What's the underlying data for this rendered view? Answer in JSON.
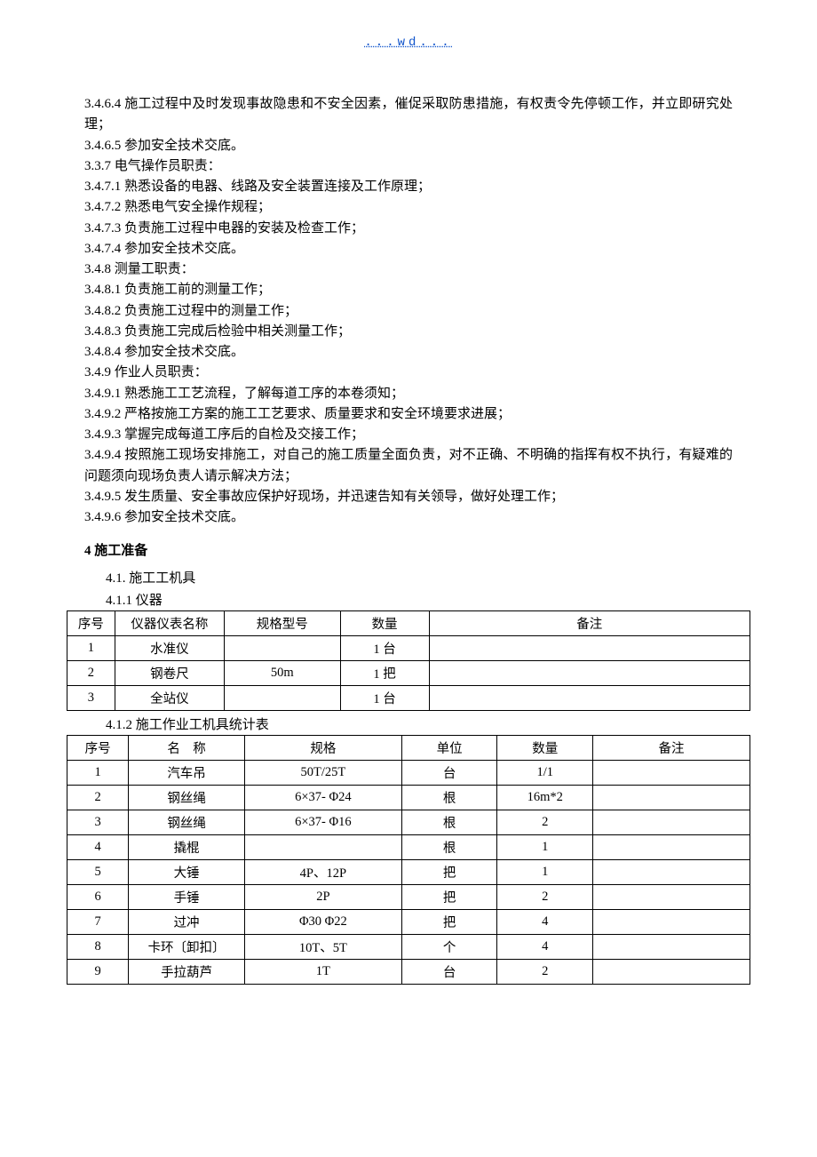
{
  "header_link": "...wd...",
  "paragraphs": [
    "3.4.6.4 施工过程中及时发现事故隐患和不安全因素，催促采取防患措施，有权责令先停顿工作，并立即研究处理；",
    "3.4.6.5 参加安全技术交底。",
    "3.3.7 电气操作员职责：",
    "3.4.7.1 熟悉设备的电器、线路及安全装置连接及工作原理；",
    "3.4.7.2 熟悉电气安全操作规程；",
    "3.4.7.3 负责施工过程中电器的安装及检查工作；",
    "3.4.7.4 参加安全技术交底。",
    "3.4.8 测量工职责：",
    "3.4.8.1 负责施工前的测量工作；",
    "3.4.8.2 负责施工过程中的测量工作；",
    "3.4.8.3 负责施工完成后检验中相关测量工作；",
    "3.4.8.4 参加安全技术交底。",
    "3.4.9 作业人员职责：",
    "3.4.9.1 熟悉施工工艺流程，了解每道工序的本卷须知；",
    "3.4.9.2 严格按施工方案的施工工艺要求、质量要求和安全环境要求进展；",
    "3.4.9.3 掌握完成每道工序后的自检及交接工作；",
    "3.4.9.4 按照施工现场安排施工，对自己的施工质量全面负责，对不正确、不明确的指挥有权不执行，有疑难的问题须向现场负责人请示解决方法；",
    "3.4.9.5 发生质量、安全事故应保护好现场，并迅速告知有关领导，做好处理工作；",
    "3.4.9.6 参加安全技术交底。"
  ],
  "section4_title": "4 施工准备",
  "sub_411": "4.1. 施工工机具",
  "sub_4111": "4.1.1 仪器",
  "table1": {
    "head": [
      "序号",
      "仪器仪表名称",
      "规格型号",
      "数量",
      "备注"
    ],
    "rows": [
      [
        "1",
        "水准仪",
        "",
        "1 台",
        ""
      ],
      [
        "2",
        "钢卷尺",
        "50m",
        "1 把",
        ""
      ],
      [
        "3",
        "全站仪",
        "",
        "1 台",
        ""
      ]
    ]
  },
  "sub_4112": "4.1.2 施工作业工机具统计表",
  "table2": {
    "head": [
      "序号",
      "名　称",
      "规格",
      "单位",
      "数量",
      "备注"
    ],
    "rows": [
      [
        "1",
        "汽车吊",
        "50T/25T",
        "台",
        "1/1",
        ""
      ],
      [
        "2",
        "钢丝绳",
        "6×37- Φ24",
        "根",
        "16m*2",
        ""
      ],
      [
        "3",
        "钢丝绳",
        "6×37- Φ16",
        "根",
        "2",
        ""
      ],
      [
        "4",
        "撬棍",
        "",
        "根",
        "1",
        ""
      ],
      [
        "5",
        "大锤",
        "4P、12P",
        "把",
        "1",
        ""
      ],
      [
        "6",
        "手锤",
        "2P",
        "把",
        "2",
        ""
      ],
      [
        "7",
        "过冲",
        "Φ30 Φ22",
        "把",
        "4",
        ""
      ],
      [
        "8",
        "卡环〔卸扣〕",
        "10T、5T",
        "个",
        "4",
        ""
      ],
      [
        "9",
        "手拉葫芦",
        "1T",
        "台",
        "2",
        ""
      ]
    ]
  }
}
